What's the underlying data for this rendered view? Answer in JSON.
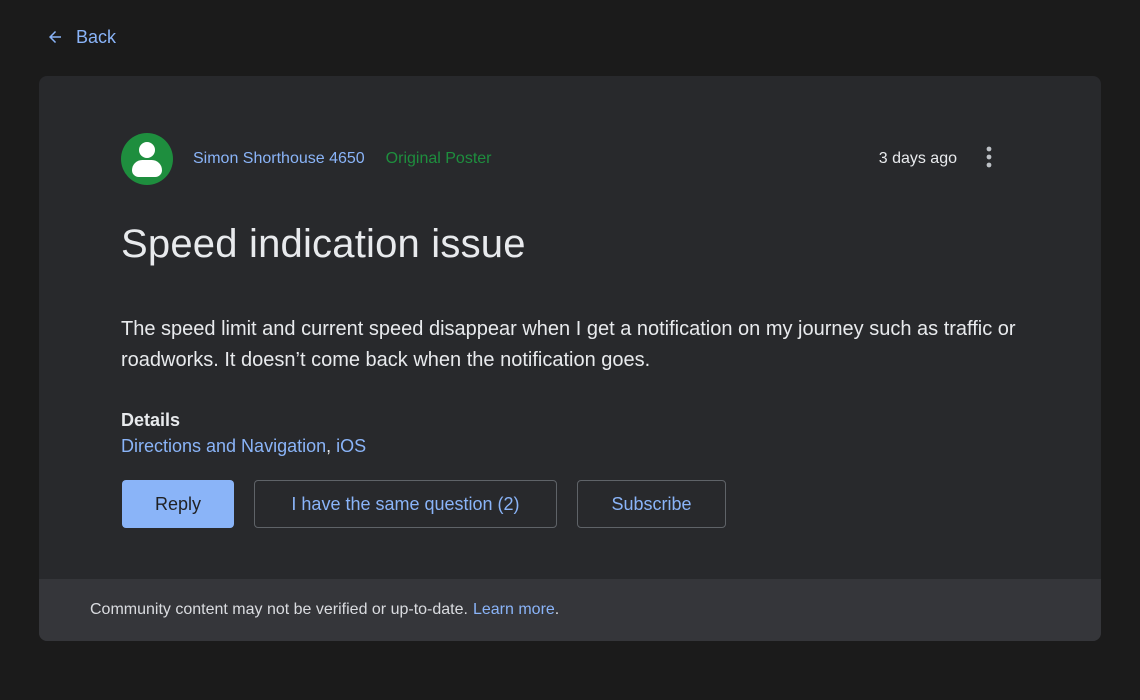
{
  "nav": {
    "back_label": "Back"
  },
  "post": {
    "author": "Simon Shorthouse 4650",
    "role": "Original Poster",
    "timestamp": "3 days ago",
    "title": "Speed indication issue",
    "body": "The speed limit and current speed disappear when I get a notification on my journey such as traffic or roadworks. It doesn’t come back when the notification goes.",
    "details_label": "Details",
    "details": [
      "Directions and Navigation",
      "iOS"
    ],
    "details_separator": ", "
  },
  "actions": {
    "reply": "Reply",
    "same_question": "I have the same question (2)",
    "subscribe": "Subscribe"
  },
  "footer": {
    "notice": "Community content may not be verified or up-to-date.",
    "learn_more": "Learn more",
    "period": "."
  },
  "colors": {
    "accent": "#8ab4f8",
    "original_poster": "#1e8e3e",
    "card_bg": "#28292c",
    "page_bg": "#1b1b1b"
  },
  "icons": {
    "back": "arrow-left-icon",
    "avatar": "person-icon",
    "more": "more-vert-icon"
  }
}
